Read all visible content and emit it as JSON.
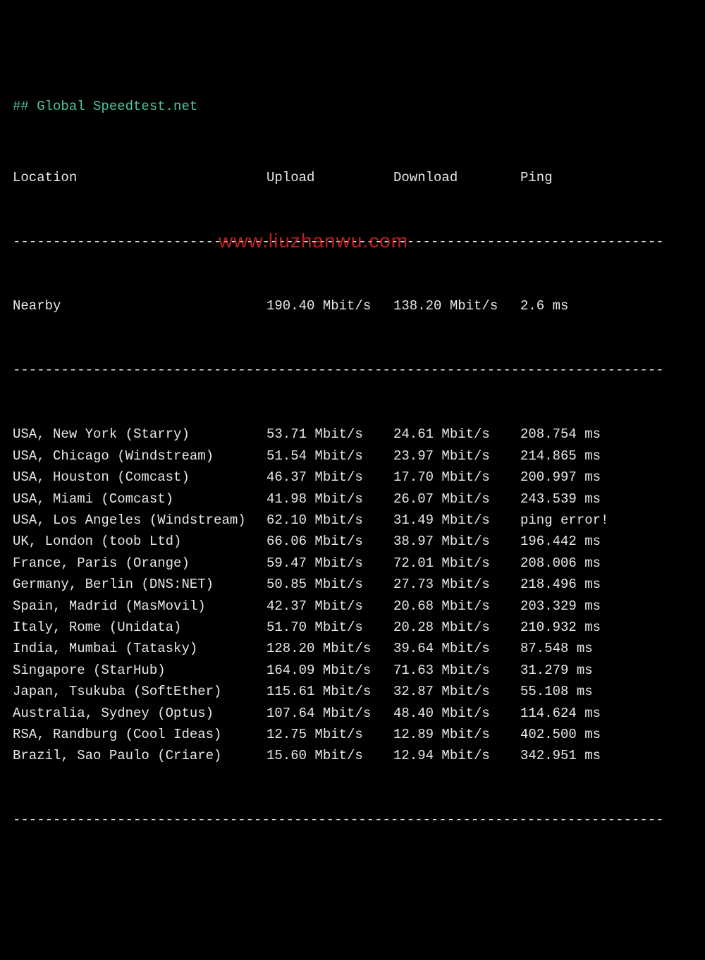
{
  "title": "## Global Speedtest.net",
  "columns": {
    "location": "Location",
    "upload": "Upload",
    "download": "Download",
    "ping": "Ping"
  },
  "divider": "---------------------------------------------------------------------------------",
  "nearby": {
    "location": "Nearby",
    "upload": "190.40 Mbit/s",
    "download": "138.20 Mbit/s",
    "ping": "2.6 ms"
  },
  "rows": [
    {
      "location": "USA, New York (Starry)",
      "upload": "53.71 Mbit/s",
      "download": "24.61 Mbit/s",
      "ping": "208.754 ms"
    },
    {
      "location": "USA, Chicago (Windstream)",
      "upload": "51.54 Mbit/s",
      "download": "23.97 Mbit/s",
      "ping": "214.865 ms"
    },
    {
      "location": "USA, Houston (Comcast)",
      "upload": "46.37 Mbit/s",
      "download": "17.70 Mbit/s",
      "ping": "200.997 ms"
    },
    {
      "location": "USA, Miami (Comcast)",
      "upload": "41.98 Mbit/s",
      "download": "26.07 Mbit/s",
      "ping": "243.539 ms"
    },
    {
      "location": "USA, Los Angeles (Windstream)",
      "upload": "62.10 Mbit/s",
      "download": "31.49 Mbit/s",
      "ping": "ping error!"
    },
    {
      "location": "UK, London (toob Ltd)",
      "upload": "66.06 Mbit/s",
      "download": "38.97 Mbit/s",
      "ping": "196.442 ms"
    },
    {
      "location": "France, Paris (Orange)",
      "upload": "59.47 Mbit/s",
      "download": "72.01 Mbit/s",
      "ping": "208.006 ms"
    },
    {
      "location": "Germany, Berlin (DNS:NET)",
      "upload": "50.85 Mbit/s",
      "download": "27.73 Mbit/s",
      "ping": "218.496 ms"
    },
    {
      "location": "Spain, Madrid (MasMovil)",
      "upload": "42.37 Mbit/s",
      "download": "20.68 Mbit/s",
      "ping": "203.329 ms"
    },
    {
      "location": "Italy, Rome (Unidata)",
      "upload": "51.70 Mbit/s",
      "download": "20.28 Mbit/s",
      "ping": "210.932 ms"
    },
    {
      "location": "India, Mumbai (Tatasky)",
      "upload": "128.20 Mbit/s",
      "download": "39.64 Mbit/s",
      "ping": "87.548 ms"
    },
    {
      "location": "Singapore (StarHub)",
      "upload": "164.09 Mbit/s",
      "download": "71.63 Mbit/s",
      "ping": "31.279 ms"
    },
    {
      "location": "Japan, Tsukuba (SoftEther)",
      "upload": "115.61 Mbit/s",
      "download": "32.87 Mbit/s",
      "ping": "55.108 ms"
    },
    {
      "location": "Australia, Sydney (Optus)",
      "upload": "107.64 Mbit/s",
      "download": "48.40 Mbit/s",
      "ping": "114.624 ms"
    },
    {
      "location": "RSA, Randburg (Cool Ideas)",
      "upload": "12.75 Mbit/s",
      "download": "12.89 Mbit/s",
      "ping": "402.500 ms"
    },
    {
      "location": "Brazil, Sao Paulo (Criare)",
      "upload": "15.60 Mbit/s",
      "download": "12.94 Mbit/s",
      "ping": "342.951 ms"
    }
  ],
  "watermark": "www.liuzhanwu.com",
  "chart_data": {
    "type": "table",
    "title": "Global Speedtest.net",
    "columns": [
      "Location",
      "Upload (Mbit/s)",
      "Download (Mbit/s)",
      "Ping (ms)"
    ],
    "rows": [
      [
        "Nearby",
        190.4,
        138.2,
        2.6
      ],
      [
        "USA, New York (Starry)",
        53.71,
        24.61,
        208.754
      ],
      [
        "USA, Chicago (Windstream)",
        51.54,
        23.97,
        214.865
      ],
      [
        "USA, Houston (Comcast)",
        46.37,
        17.7,
        200.997
      ],
      [
        "USA, Miami (Comcast)",
        41.98,
        26.07,
        243.539
      ],
      [
        "USA, Los Angeles (Windstream)",
        62.1,
        31.49,
        null
      ],
      [
        "UK, London (toob Ltd)",
        66.06,
        38.97,
        196.442
      ],
      [
        "France, Paris (Orange)",
        59.47,
        72.01,
        208.006
      ],
      [
        "Germany, Berlin (DNS:NET)",
        50.85,
        27.73,
        218.496
      ],
      [
        "Spain, Madrid (MasMovil)",
        42.37,
        20.68,
        203.329
      ],
      [
        "Italy, Rome (Unidata)",
        51.7,
        20.28,
        210.932
      ],
      [
        "India, Mumbai (Tatasky)",
        128.2,
        39.64,
        87.548
      ],
      [
        "Singapore (StarHub)",
        164.09,
        71.63,
        31.279
      ],
      [
        "Japan, Tsukuba (SoftEther)",
        115.61,
        32.87,
        55.108
      ],
      [
        "Australia, Sydney (Optus)",
        107.64,
        48.4,
        114.624
      ],
      [
        "RSA, Randburg (Cool Ideas)",
        12.75,
        12.89,
        402.5
      ],
      [
        "Brazil, Sao Paulo (Criare)",
        15.6,
        12.94,
        342.951
      ]
    ]
  }
}
